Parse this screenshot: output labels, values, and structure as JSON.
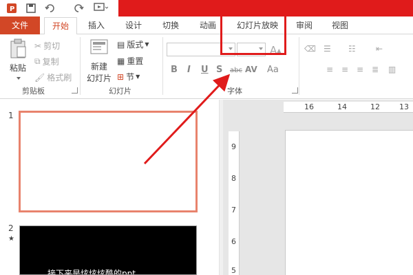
{
  "title_bar": {
    "quick_access": [
      "powerpoint-logo-icon",
      "save-icon",
      "undo-icon",
      "redo-icon",
      "present-icon"
    ]
  },
  "tabs": [
    {
      "label": "文件"
    },
    {
      "label": "开始"
    },
    {
      "label": "插入"
    },
    {
      "label": "设计"
    },
    {
      "label": "切换"
    },
    {
      "label": "动画"
    },
    {
      "label": "幻灯片放映"
    },
    {
      "label": "审阅"
    },
    {
      "label": "视图"
    }
  ],
  "ribbon": {
    "clipboard": {
      "paste": "粘贴",
      "cut": "剪切",
      "copy": "复制",
      "format_painter": "格式刷",
      "group_label": "剪贴板"
    },
    "slides": {
      "new_slide_line1": "新建",
      "new_slide_line2": "幻灯片",
      "layout": "版式",
      "reset": "重置",
      "section": "节",
      "group_label": "幻灯片"
    },
    "font": {
      "bold": "B",
      "italic": "I",
      "underline": "U",
      "shadow": "S",
      "strike": "abc",
      "spacing": "AV",
      "case": "Aa",
      "grow": "A",
      "group_label": "字体"
    }
  },
  "slide_pane": {
    "slides": [
      {
        "number": "1",
        "text": ""
      },
      {
        "number": "2",
        "marker": "★",
        "text": "接下来是炫炫炫酷的ppt"
      }
    ]
  },
  "editor": {
    "ruler_top": [
      "16",
      "14",
      "12",
      "13"
    ],
    "ruler_left": [
      "9",
      "8",
      "7",
      "6",
      "5"
    ]
  },
  "colors": {
    "accent": "#d24726",
    "title_red": "#e01b1b",
    "annotation": "#e01b1b"
  }
}
